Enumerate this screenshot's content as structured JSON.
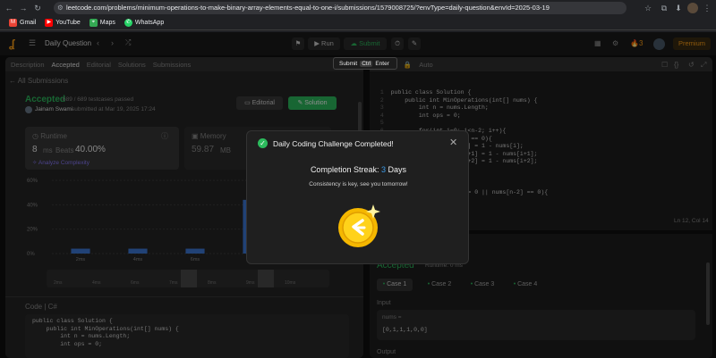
{
  "browser": {
    "url": "leetcode.com/problems/minimum-operations-to-make-binary-array-elements-equal-to-one-i/submissions/1579008725/?envType=daily-question&envId=2025-03-19",
    "bookmarks": [
      "Gmail",
      "YouTube",
      "Maps",
      "WhatsApp"
    ]
  },
  "header": {
    "title": "Daily Question",
    "run_label": "Run",
    "submit_label": "Submit",
    "streak": "3",
    "premium_label": "Premium"
  },
  "left_tabs": [
    "Description",
    "Accepted",
    "Editorial",
    "Solutions",
    "Submissions"
  ],
  "submission": {
    "back_label": "All Submissions",
    "status": "Accepted",
    "testcases": "689 / 689 testcases passed",
    "user": "Jainam Swami",
    "submitted_at": "submitted at Mar 19, 2025 17:24",
    "editorial_btn": "Editorial",
    "solution_btn": "Solution",
    "runtime_label": "Runtime",
    "runtime_value": "8",
    "runtime_unit": "ms",
    "beats_label": "Beats",
    "beats_value": "40.00%",
    "analyze_label": "Analyze Complexity",
    "memory_label": "Memory",
    "memory_value": "59.87",
    "memory_unit": "MB",
    "y_ticks": [
      "60%",
      "40%",
      "20%",
      "0%"
    ],
    "x_ticks": [
      "2ms",
      "4ms",
      "6ms",
      "7ms",
      "9ms"
    ],
    "mini_ticks": [
      "2ms",
      "4ms",
      "6ms",
      "7ms",
      "8ms",
      "9ms",
      "10ms"
    ],
    "code_label": "Code",
    "lang": "C#"
  },
  "chart_data": {
    "type": "bar",
    "categories": [
      "2ms",
      "4ms",
      "6ms",
      "7ms",
      "9ms"
    ],
    "values": [
      4,
      4,
      4,
      44,
      4
    ],
    "ylim": [
      0,
      60
    ]
  },
  "editor": {
    "lang": "C#",
    "mode": "Auto",
    "cursor": "Ln 12, Col 14",
    "lines": [
      "public class Solution {",
      "    public int MinOperations(int[] nums) {",
      "        int n = nums.Length;",
      "        int ops = 0;",
      "",
      "        for(int i=0; i<n-2; i++){",
      "            if(nums[i] == 0){",
      "                nums[i] = 1 - nums[i];",
      "                nums[i+1] = 1 - nums[i+1];",
      "                nums[i+2] = 1 - nums[i+2];",
      "            }",
      "        }",
      "",
      "        if(nums[n-1] == 0 || nums[n-2] == 0){"
    ]
  },
  "left_code": [
    "public class Solution {",
    "    public int MinOperations(int[] nums) {",
    "        int n = nums.Length;",
    "        int ops = 0;"
  ],
  "testcase": {
    "result_status": "Accepted",
    "runtime": "Runtime: 0 ms",
    "cases": [
      "Case 1",
      "Case 2",
      "Case 3",
      "Case 4"
    ],
    "input_label": "Input",
    "var_label": "nums =",
    "input_value": "[0,1,1,1,0,0]",
    "output_label": "Output"
  },
  "tooltip": {
    "submit": "Submit",
    "ctrl": "Ctrl",
    "enter": "Enter"
  },
  "modal": {
    "title": "Daily Coding Challenge Completed!",
    "streak_label": "Completion Streak:",
    "streak_value": "3",
    "streak_unit": "Days",
    "message": "Consistency is key, see you tomorrow!"
  }
}
